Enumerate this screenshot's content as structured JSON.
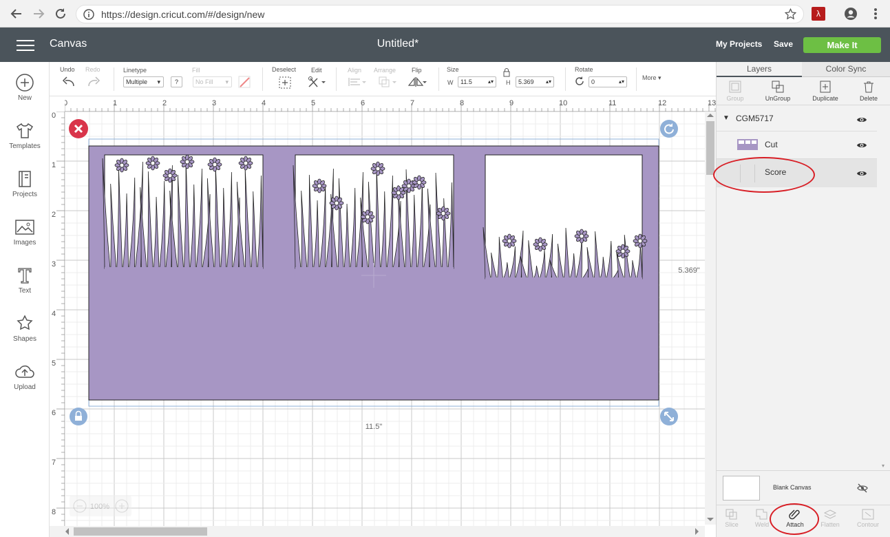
{
  "browser": {
    "url": "https://design.cricut.com/#/design/new"
  },
  "header": {
    "app_title": "Canvas",
    "doc_title": "Untitled*",
    "my_projects": "My Projects",
    "save": "Save",
    "make_it": "Make It"
  },
  "sidebar": {
    "items": [
      {
        "label": "New",
        "icon": "plus-circle-icon"
      },
      {
        "label": "Templates",
        "icon": "tshirt-icon"
      },
      {
        "label": "Projects",
        "icon": "projects-icon"
      },
      {
        "label": "Images",
        "icon": "image-icon"
      },
      {
        "label": "Text",
        "icon": "text-icon"
      },
      {
        "label": "Shapes",
        "icon": "shapes-icon"
      },
      {
        "label": "Upload",
        "icon": "upload-cloud-icon"
      }
    ]
  },
  "toolbar": {
    "undo": "Undo",
    "redo": "Redo",
    "linetype_label": "Linetype",
    "linetype_value": "Multiple",
    "help": "?",
    "fill_label": "Fill",
    "fill_value": "No Fill",
    "deselect": "Deselect",
    "edit": "Edit",
    "align": "Align",
    "arrange": "Arrange",
    "flip": "Flip",
    "size_label": "Size",
    "w_label": "W",
    "w_value": "11.5",
    "h_label": "H",
    "h_value": "5.369",
    "rotate_label": "Rotate",
    "rotate_value": "0",
    "more": "More"
  },
  "canvas": {
    "ruler_top": [
      "0",
      "1",
      "2",
      "3",
      "4",
      "5",
      "6",
      "7",
      "8",
      "9",
      "10",
      "11",
      "12",
      "13"
    ],
    "ruler_left": [
      "0",
      "1",
      "2",
      "3",
      "4",
      "5",
      "6",
      "7",
      "8"
    ],
    "width_label": "11.5\"",
    "height_label": "5.369\"",
    "zoom": "100%",
    "fill_color": "#a796c4"
  },
  "panel": {
    "tabs": [
      "Layers",
      "Color Sync"
    ],
    "actions": [
      "Group",
      "UnGroup",
      "Duplicate",
      "Delete"
    ],
    "group_name": "CGM5717",
    "layers": [
      {
        "name": "Cut"
      },
      {
        "name": "Score"
      }
    ],
    "blank_canvas": "Blank Canvas",
    "bottom_actions": [
      "Slice",
      "Weld",
      "Attach",
      "Flatten",
      "Contour"
    ]
  },
  "colors": {
    "header_bg": "#4b545b",
    "make_it_bg": "#6dbf44",
    "annotation": "#d81f26",
    "accent_blue": "#8fb0d8"
  }
}
